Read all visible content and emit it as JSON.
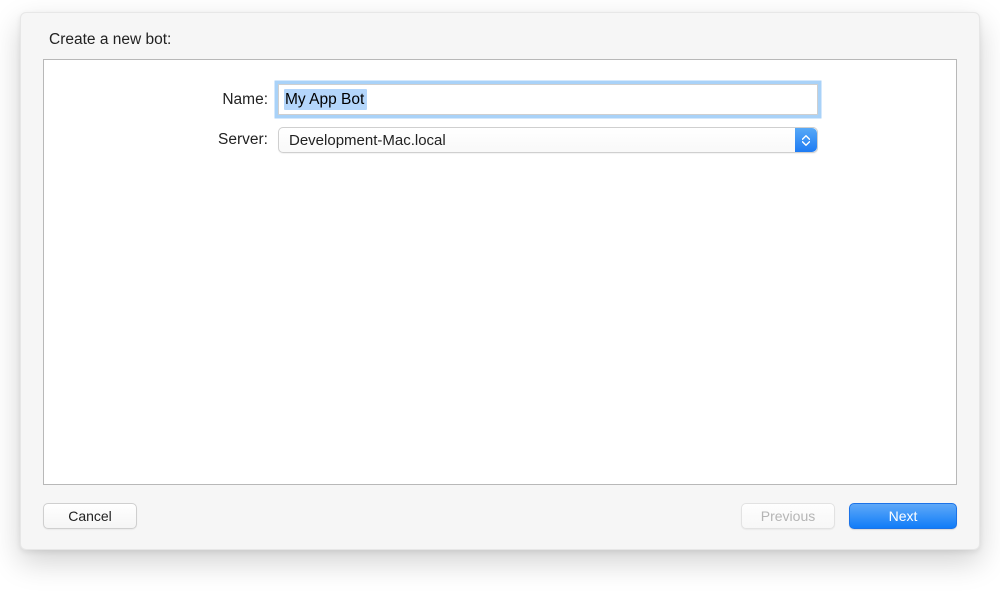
{
  "title": "Create a new bot:",
  "form": {
    "nameLabel": "Name:",
    "nameValue": "My App Bot",
    "serverLabel": "Server:",
    "serverValue": "Development-Mac.local"
  },
  "buttons": {
    "cancel": "Cancel",
    "previous": "Previous",
    "next": "Next"
  }
}
